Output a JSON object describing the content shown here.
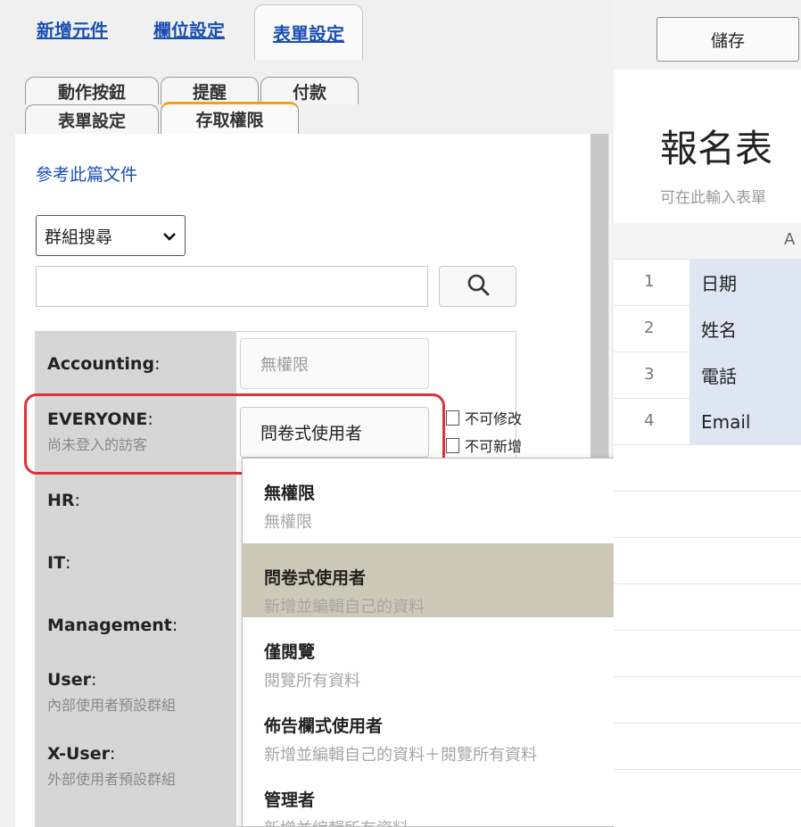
{
  "top_tabs": [
    "新增元件",
    "欄位設定",
    "表單設定"
  ],
  "sub_tabs_row1": [
    "動作按鈕",
    "提醒",
    "付款"
  ],
  "sub_tabs_row2": [
    "表單設定",
    "存取權限"
  ],
  "doc_link": "參考此篇文件",
  "group_search": {
    "selected": "群組搜尋",
    "value": "",
    "placeholder": ""
  },
  "groups": [
    {
      "name": "Accounting",
      "desc": "",
      "permission": "無權限"
    },
    {
      "name": "EVERYONE",
      "desc": "尚未登入的訪客",
      "permission": "問卷式使用者"
    },
    {
      "name": "HR",
      "desc": ""
    },
    {
      "name": "IT",
      "desc": ""
    },
    {
      "name": "Management",
      "desc": ""
    },
    {
      "name": "User",
      "desc": "內部使用者預設群組"
    },
    {
      "name": "X-User",
      "desc": "外部使用者預設群組"
    }
  ],
  "colon": ":",
  "checkboxes": [
    "不可修改",
    "不可新增"
  ],
  "permission_options": [
    {
      "title": "無權限",
      "desc": "無權限"
    },
    {
      "title": "問卷式使用者",
      "desc": "新增並編輯自己的資料"
    },
    {
      "title": "僅閱覽",
      "desc": "閱覽所有資料"
    },
    {
      "title": "佈告欄式使用者",
      "desc": "新增並編輯自己的資料＋閱覽所有資料"
    },
    {
      "title": "管理者",
      "desc": "新增並編輯所有資料"
    }
  ],
  "selected_option_index": 1,
  "save_label": "儲存",
  "form": {
    "title": "報名表",
    "subtitle": "可在此輸入表單",
    "column": "A",
    "rows": [
      {
        "num": "1",
        "field": "日期"
      },
      {
        "num": "2",
        "field": "姓名"
      },
      {
        "num": "3",
        "field": "電話"
      },
      {
        "num": "4",
        "field": "Email"
      }
    ]
  },
  "colors": {
    "link": "#1a4fb3",
    "active_tab": "#f0a020",
    "highlight": "#e1303a",
    "selected_option": "#cdc9b8",
    "field_cell": "#dde6f2"
  },
  "icons": {
    "search": "search-icon",
    "dropdown": "chevron-down-icon"
  }
}
